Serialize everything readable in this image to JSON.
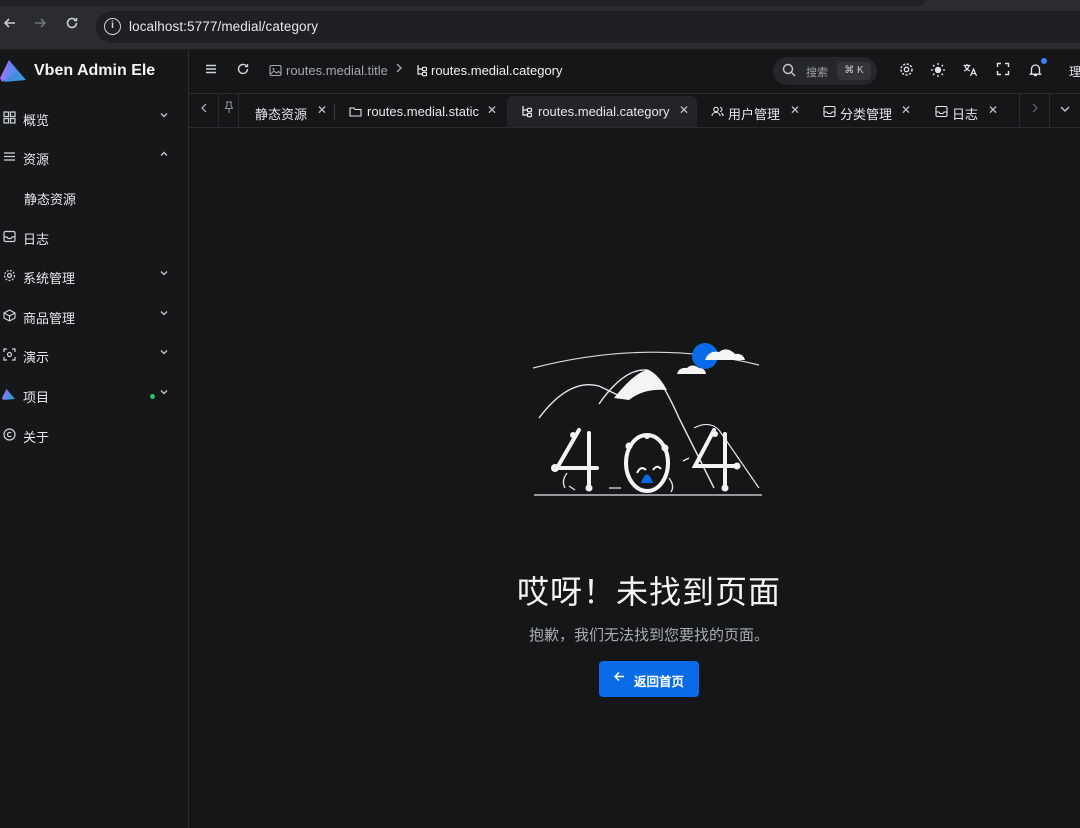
{
  "browser": {
    "back_icon": "arrow-left-icon",
    "forward_icon": "arrow-right-icon",
    "reload_icon": "reload-icon",
    "url": "localhost:5777/medial/category"
  },
  "app": {
    "name": "Vben Admin Ele",
    "accent": "#0a6be8"
  },
  "sidebar": {
    "items": [
      {
        "label": "概览",
        "icon": "dashboard-icon",
        "chevron": "down"
      },
      {
        "label": "资源",
        "icon": "menu-icon",
        "chevron": "up"
      },
      {
        "label": "静态资源",
        "icon": "",
        "chevron": ""
      },
      {
        "label": "日志",
        "icon": "inbox-icon",
        "chevron": ""
      },
      {
        "label": "系统管理",
        "icon": "gear-icon",
        "chevron": "down"
      },
      {
        "label": "商品管理",
        "icon": "cube-icon",
        "chevron": "down"
      },
      {
        "label": "演示",
        "icon": "scan-icon",
        "chevron": "down"
      },
      {
        "label": "项目",
        "icon": "logo-icon",
        "chevron": "down"
      },
      {
        "label": "关于",
        "icon": "copyright-icon",
        "chevron": ""
      }
    ]
  },
  "header": {
    "breadcrumb": [
      "routes.medial.title",
      "routes.medial.category"
    ],
    "search_placeholder": "搜索",
    "search_shortcut": "⌘ K",
    "user_initial": "理"
  },
  "tabs": [
    {
      "label": "静态资源",
      "active": false
    },
    {
      "label": "routes.medial.static",
      "active": false
    },
    {
      "label": "routes.medial.category",
      "active": true
    },
    {
      "label": "用户管理",
      "active": false
    },
    {
      "label": "分类管理",
      "active": false
    },
    {
      "label": "日志",
      "active": false
    }
  ],
  "error": {
    "title": "哎呀！未找到页面",
    "description": "抱歉，我们无法找到您要找的页面。",
    "button": "返回首页",
    "illustration_text": "404"
  }
}
